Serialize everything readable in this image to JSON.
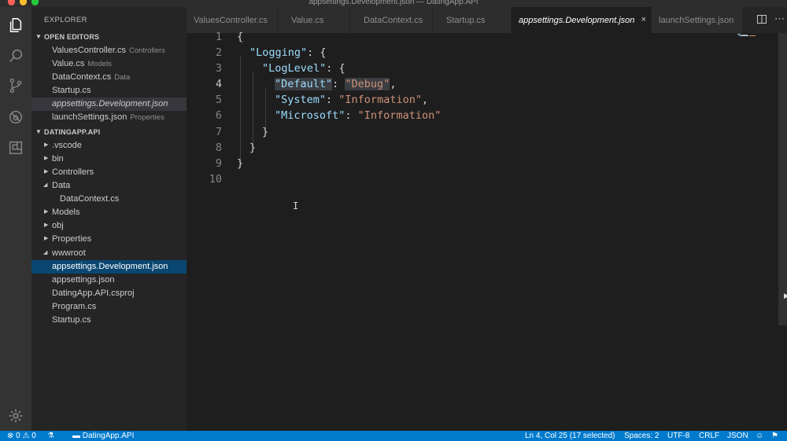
{
  "window": {
    "title": "appsettings.Development.json — DatingApp.API"
  },
  "activity": [
    "files-icon",
    "search-icon",
    "source-control-icon",
    "debug-icon",
    "extensions-icon",
    "gear-icon"
  ],
  "sidebar": {
    "title": "EXPLORER",
    "open_editors": {
      "header": "OPEN EDITORS",
      "items": [
        {
          "name": "ValuesController.cs",
          "desc": "Controllers"
        },
        {
          "name": "Value.cs",
          "desc": "Models"
        },
        {
          "name": "DataContext.cs",
          "desc": "Data"
        },
        {
          "name": "Startup.cs",
          "desc": ""
        },
        {
          "name": "appsettings.Development.json",
          "desc": ""
        },
        {
          "name": "launchSettings.json",
          "desc": "Properties"
        }
      ]
    },
    "project": {
      "header": "DATINGAPP.API",
      "items": [
        {
          "name": ".vscode",
          "type": "folder",
          "expanded": false
        },
        {
          "name": "bin",
          "type": "folder",
          "expanded": false
        },
        {
          "name": "Controllers",
          "type": "folder",
          "expanded": false
        },
        {
          "name": "Data",
          "type": "folder",
          "expanded": true
        },
        {
          "name": "DataContext.cs",
          "type": "file"
        },
        {
          "name": "Models",
          "type": "folder",
          "expanded": false
        },
        {
          "name": "obj",
          "type": "folder",
          "expanded": false
        },
        {
          "name": "Properties",
          "type": "folder",
          "expanded": false
        },
        {
          "name": "wwwroot",
          "type": "folder",
          "expanded": true
        },
        {
          "name": "appsettings.Development.json",
          "type": "file",
          "selected": true
        },
        {
          "name": "appsettings.json",
          "type": "file"
        },
        {
          "name": "DatingApp.API.csproj",
          "type": "file"
        },
        {
          "name": "Program.cs",
          "type": "file"
        },
        {
          "name": "Startup.cs",
          "type": "file"
        }
      ]
    }
  },
  "tabs": [
    {
      "label": "ValuesController.cs",
      "active": false
    },
    {
      "label": "Value.cs",
      "active": false
    },
    {
      "label": "DataContext.cs",
      "active": false
    },
    {
      "label": "Startup.cs",
      "active": false
    },
    {
      "label": "appsettings.Development.json",
      "active": true,
      "close": "×"
    },
    {
      "label": "launchSettings.json",
      "active": false
    }
  ],
  "editor": {
    "line_numbers": [
      "1",
      "2",
      "3",
      "4",
      "5",
      "6",
      "7",
      "8",
      "9",
      "10"
    ],
    "current_line": "4",
    "lines": {
      "l1": {
        "open": "{"
      },
      "l2": {
        "key": "\"Logging\"",
        "rest": ": {"
      },
      "l3": {
        "key": "\"LogLevel\"",
        "rest": ": {"
      },
      "l4": {
        "key": "\"Default\"",
        "colon": ": ",
        "value": "\"Debug\"",
        "tail": ","
      },
      "l5": {
        "key": "\"System\"",
        "colon": ": ",
        "value": "\"Information\"",
        "tail": ","
      },
      "l6": {
        "key": "\"Microsoft\"",
        "colon": ": ",
        "value": "\"Information\""
      },
      "l7": {
        "close": "}"
      },
      "l8": {
        "close": "}"
      },
      "l9": {
        "close": "}"
      }
    }
  },
  "statusbar": {
    "errors": "0",
    "warnings": "0",
    "folder": "DatingApp.API",
    "position": "Ln 4, Col 25 (17 selected)",
    "spaces": "Spaces: 2",
    "encoding": "UTF-8",
    "eol": "CRLF",
    "language": "JSON"
  },
  "colors": {
    "statusbar": "#007acc",
    "selection": "#094771",
    "json_key": "#9cdcfe",
    "json_string": "#ce9178"
  }
}
